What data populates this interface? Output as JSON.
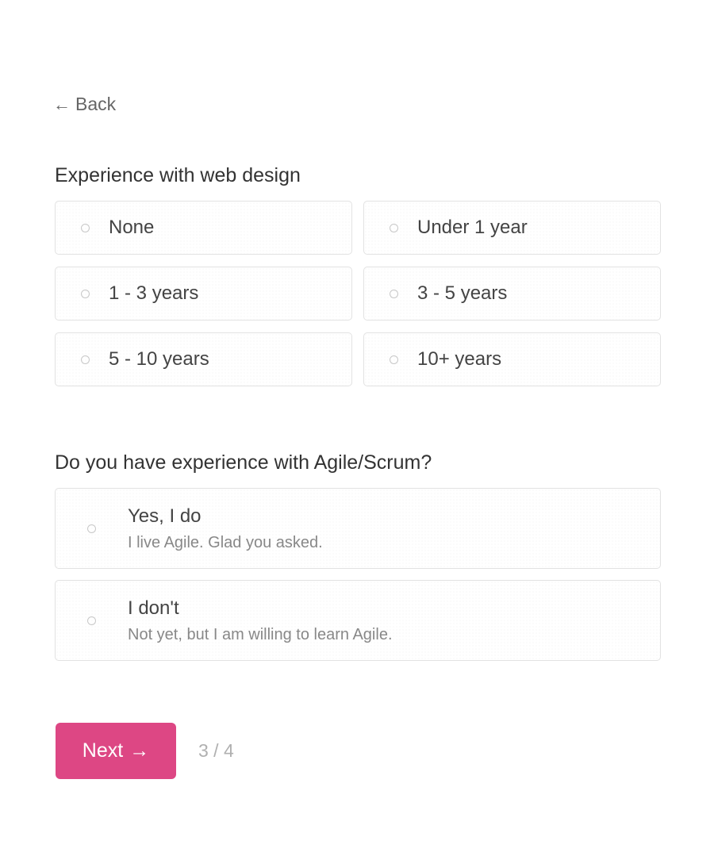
{
  "nav": {
    "back_icon": "arrow-left-icon",
    "back_label": "Back"
  },
  "question1": {
    "title": "Experience with web design",
    "options": [
      "None",
      "Under 1 year",
      "1 - 3 years",
      "3 - 5 years",
      "5 - 10 years",
      "10+ years"
    ]
  },
  "question2": {
    "title": "Do you have experience with Agile/Scrum?",
    "options": [
      {
        "title": "Yes, I do",
        "subtitle": "I live Agile. Glad you asked."
      },
      {
        "title": "I don't",
        "subtitle": "Not yet, but I am willing to learn Agile."
      }
    ]
  },
  "footer": {
    "next_label": "Next",
    "next_icon": "arrow-right-icon",
    "progress": "3 / 4"
  },
  "colors": {
    "accent": "#dd4784"
  }
}
